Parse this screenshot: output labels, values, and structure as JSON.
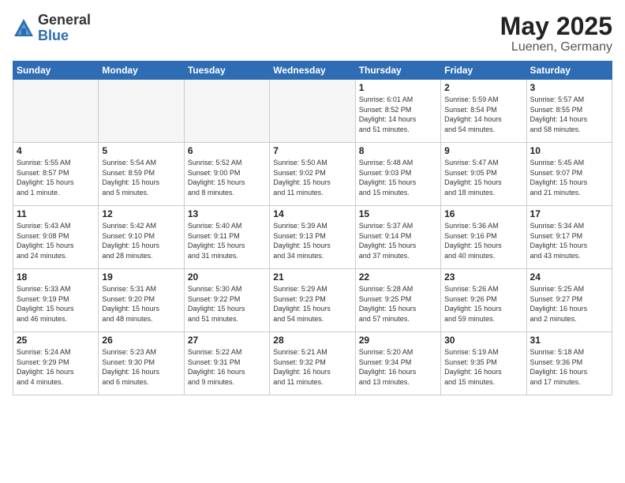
{
  "logo": {
    "general": "General",
    "blue": "Blue"
  },
  "title": "May 2025",
  "location": "Luenen, Germany",
  "headers": [
    "Sunday",
    "Monday",
    "Tuesday",
    "Wednesday",
    "Thursday",
    "Friday",
    "Saturday"
  ],
  "weeks": [
    [
      {
        "day": "",
        "empty": true
      },
      {
        "day": "",
        "empty": true
      },
      {
        "day": "",
        "empty": true
      },
      {
        "day": "",
        "empty": true
      },
      {
        "day": "1",
        "info": "Sunrise: 6:01 AM\nSunset: 8:52 PM\nDaylight: 14 hours\nand 51 minutes."
      },
      {
        "day": "2",
        "info": "Sunrise: 5:59 AM\nSunset: 8:54 PM\nDaylight: 14 hours\nand 54 minutes."
      },
      {
        "day": "3",
        "info": "Sunrise: 5:57 AM\nSunset: 8:55 PM\nDaylight: 14 hours\nand 58 minutes."
      }
    ],
    [
      {
        "day": "4",
        "info": "Sunrise: 5:55 AM\nSunset: 8:57 PM\nDaylight: 15 hours\nand 1 minute."
      },
      {
        "day": "5",
        "info": "Sunrise: 5:54 AM\nSunset: 8:59 PM\nDaylight: 15 hours\nand 5 minutes."
      },
      {
        "day": "6",
        "info": "Sunrise: 5:52 AM\nSunset: 9:00 PM\nDaylight: 15 hours\nand 8 minutes."
      },
      {
        "day": "7",
        "info": "Sunrise: 5:50 AM\nSunset: 9:02 PM\nDaylight: 15 hours\nand 11 minutes."
      },
      {
        "day": "8",
        "info": "Sunrise: 5:48 AM\nSunset: 9:03 PM\nDaylight: 15 hours\nand 15 minutes."
      },
      {
        "day": "9",
        "info": "Sunrise: 5:47 AM\nSunset: 9:05 PM\nDaylight: 15 hours\nand 18 minutes."
      },
      {
        "day": "10",
        "info": "Sunrise: 5:45 AM\nSunset: 9:07 PM\nDaylight: 15 hours\nand 21 minutes."
      }
    ],
    [
      {
        "day": "11",
        "info": "Sunrise: 5:43 AM\nSunset: 9:08 PM\nDaylight: 15 hours\nand 24 minutes."
      },
      {
        "day": "12",
        "info": "Sunrise: 5:42 AM\nSunset: 9:10 PM\nDaylight: 15 hours\nand 28 minutes."
      },
      {
        "day": "13",
        "info": "Sunrise: 5:40 AM\nSunset: 9:11 PM\nDaylight: 15 hours\nand 31 minutes."
      },
      {
        "day": "14",
        "info": "Sunrise: 5:39 AM\nSunset: 9:13 PM\nDaylight: 15 hours\nand 34 minutes."
      },
      {
        "day": "15",
        "info": "Sunrise: 5:37 AM\nSunset: 9:14 PM\nDaylight: 15 hours\nand 37 minutes."
      },
      {
        "day": "16",
        "info": "Sunrise: 5:36 AM\nSunset: 9:16 PM\nDaylight: 15 hours\nand 40 minutes."
      },
      {
        "day": "17",
        "info": "Sunrise: 5:34 AM\nSunset: 9:17 PM\nDaylight: 15 hours\nand 43 minutes."
      }
    ],
    [
      {
        "day": "18",
        "info": "Sunrise: 5:33 AM\nSunset: 9:19 PM\nDaylight: 15 hours\nand 46 minutes."
      },
      {
        "day": "19",
        "info": "Sunrise: 5:31 AM\nSunset: 9:20 PM\nDaylight: 15 hours\nand 48 minutes."
      },
      {
        "day": "20",
        "info": "Sunrise: 5:30 AM\nSunset: 9:22 PM\nDaylight: 15 hours\nand 51 minutes."
      },
      {
        "day": "21",
        "info": "Sunrise: 5:29 AM\nSunset: 9:23 PM\nDaylight: 15 hours\nand 54 minutes."
      },
      {
        "day": "22",
        "info": "Sunrise: 5:28 AM\nSunset: 9:25 PM\nDaylight: 15 hours\nand 57 minutes."
      },
      {
        "day": "23",
        "info": "Sunrise: 5:26 AM\nSunset: 9:26 PM\nDaylight: 15 hours\nand 59 minutes."
      },
      {
        "day": "24",
        "info": "Sunrise: 5:25 AM\nSunset: 9:27 PM\nDaylight: 16 hours\nand 2 minutes."
      }
    ],
    [
      {
        "day": "25",
        "info": "Sunrise: 5:24 AM\nSunset: 9:29 PM\nDaylight: 16 hours\nand 4 minutes."
      },
      {
        "day": "26",
        "info": "Sunrise: 5:23 AM\nSunset: 9:30 PM\nDaylight: 16 hours\nand 6 minutes."
      },
      {
        "day": "27",
        "info": "Sunrise: 5:22 AM\nSunset: 9:31 PM\nDaylight: 16 hours\nand 9 minutes."
      },
      {
        "day": "28",
        "info": "Sunrise: 5:21 AM\nSunset: 9:32 PM\nDaylight: 16 hours\nand 11 minutes."
      },
      {
        "day": "29",
        "info": "Sunrise: 5:20 AM\nSunset: 9:34 PM\nDaylight: 16 hours\nand 13 minutes."
      },
      {
        "day": "30",
        "info": "Sunrise: 5:19 AM\nSunset: 9:35 PM\nDaylight: 16 hours\nand 15 minutes."
      },
      {
        "day": "31",
        "info": "Sunrise: 5:18 AM\nSunset: 9:36 PM\nDaylight: 16 hours\nand 17 minutes."
      }
    ]
  ]
}
